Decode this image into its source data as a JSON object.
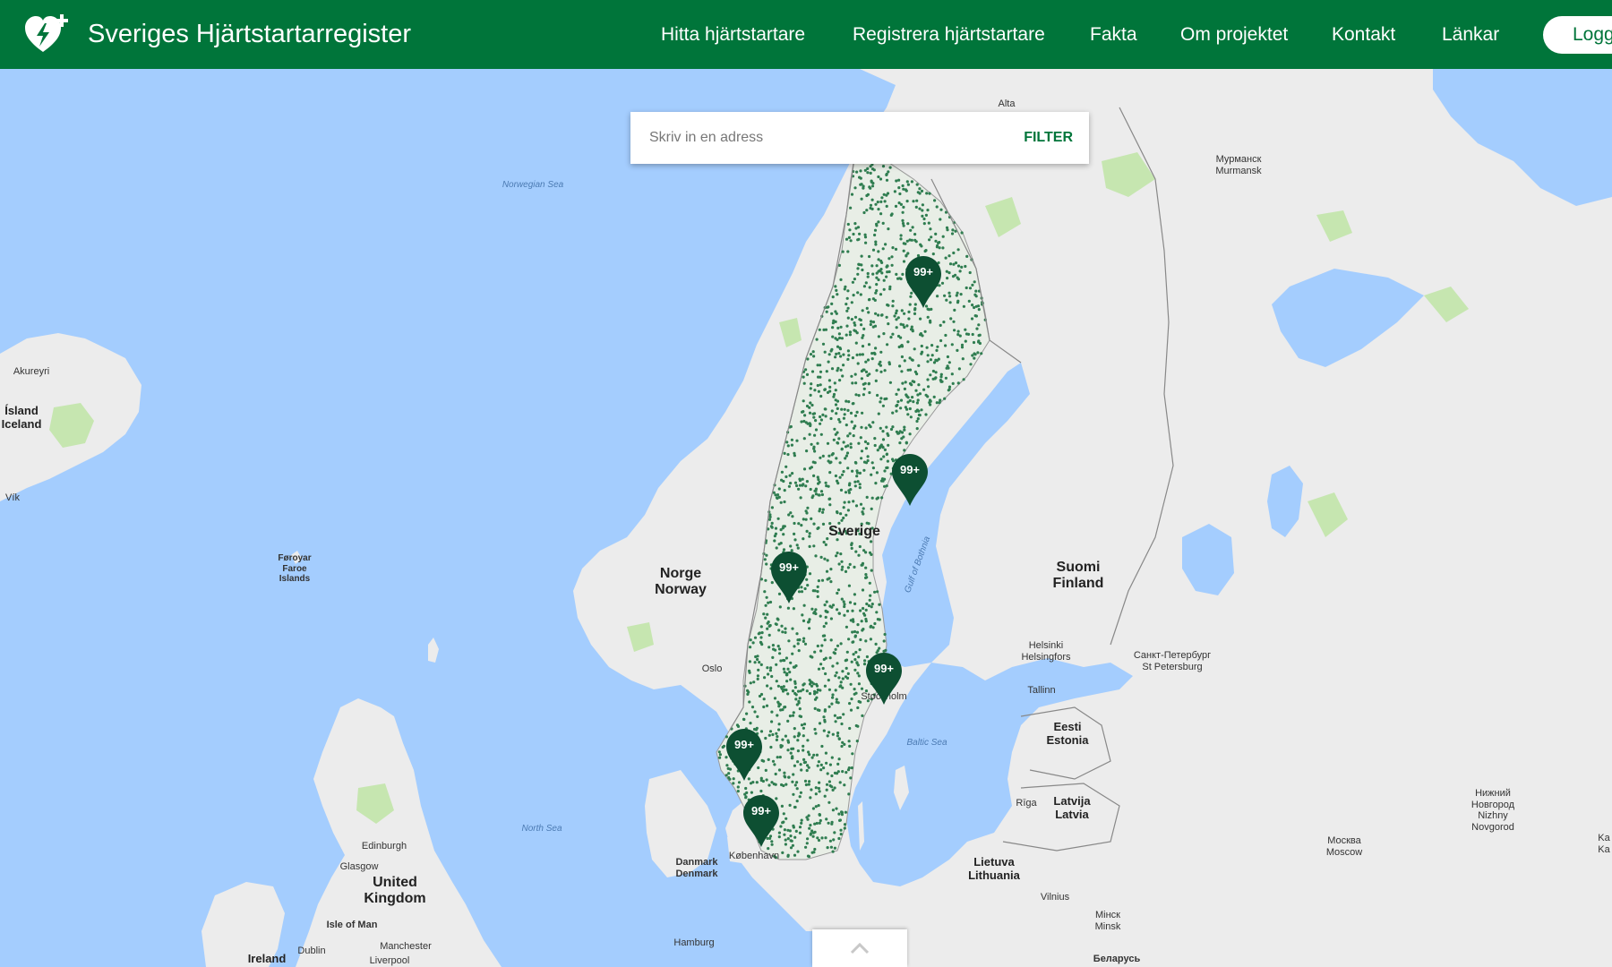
{
  "header": {
    "site_title": "Sveriges Hjärtstartarregister",
    "brand_color": "#00753a",
    "nav": [
      {
        "label": "Hitta hjärtstartare"
      },
      {
        "label": "Registrera hjärtstartare"
      },
      {
        "label": "Fakta"
      },
      {
        "label": "Om projektet"
      },
      {
        "label": "Kontakt"
      },
      {
        "label": "Länkar"
      }
    ],
    "login_label": "Logga in"
  },
  "search": {
    "placeholder": "Skriv in en adress",
    "value": "",
    "filter_label": "FILTER"
  },
  "map": {
    "colors": {
      "water": "#a4cdfe",
      "land": "#ececec",
      "forest": "#c6e6b0",
      "marker": "#0d4f32",
      "dot": "#2f7d50"
    },
    "labels": {
      "alta": "Alta",
      "murmansk": "Мурманск\nMurmansk",
      "norwegian_sea": "Norwegian Sea",
      "akureyri": "Akureyri",
      "iceland": "Ísland\nIceland",
      "vik": "Vík",
      "faroe": "Føroyar\nFaroe\nIslands",
      "norway": "Norge\nNorway",
      "sweden": "Sverige",
      "gulf_bothnia": "Gulf of Bothnia",
      "finland": "Suomi\nFinland",
      "oslo": "Oslo",
      "helsinki": "Helsinki\nHelsingfors",
      "stpetersburg": "Санкт-Петербург\nSt Petersburg",
      "stockholm": "Stockholm",
      "tallinn": "Tallinn",
      "estonia": "Eesti\nEstonia",
      "baltic_sea": "Baltic Sea",
      "riga": "Rīga",
      "latvia": "Latvija\nLatvia",
      "north_sea": "North Sea",
      "denmark": "Danmark\nDenmark",
      "kobenhavn": "København",
      "edinburgh": "Edinburgh",
      "glasgow": "Glasgow",
      "uk": "United\nKingdom",
      "isle_of_man": "Isle of Man",
      "lithuania": "Lietuva\nLithuania",
      "vilnius": "Vilnius",
      "nizhny": "Нижний\nНовгород\nNizhny\nNovgorod",
      "moscow": "Москва\nMoscow",
      "kazan": "Ka\nKa",
      "minsk": "Мінск\nMinsk",
      "belarus": "Беларусь",
      "hamburg": "Hamburg",
      "dublin": "Dublin",
      "ireland": "Ireland",
      "manchester": "Manchester",
      "liverpool": "Liverpool"
    },
    "clusters": [
      {
        "count": "99+"
      },
      {
        "count": "99+"
      },
      {
        "count": "99+"
      },
      {
        "count": "99+"
      },
      {
        "count": "99+"
      },
      {
        "count": "99+"
      }
    ]
  }
}
